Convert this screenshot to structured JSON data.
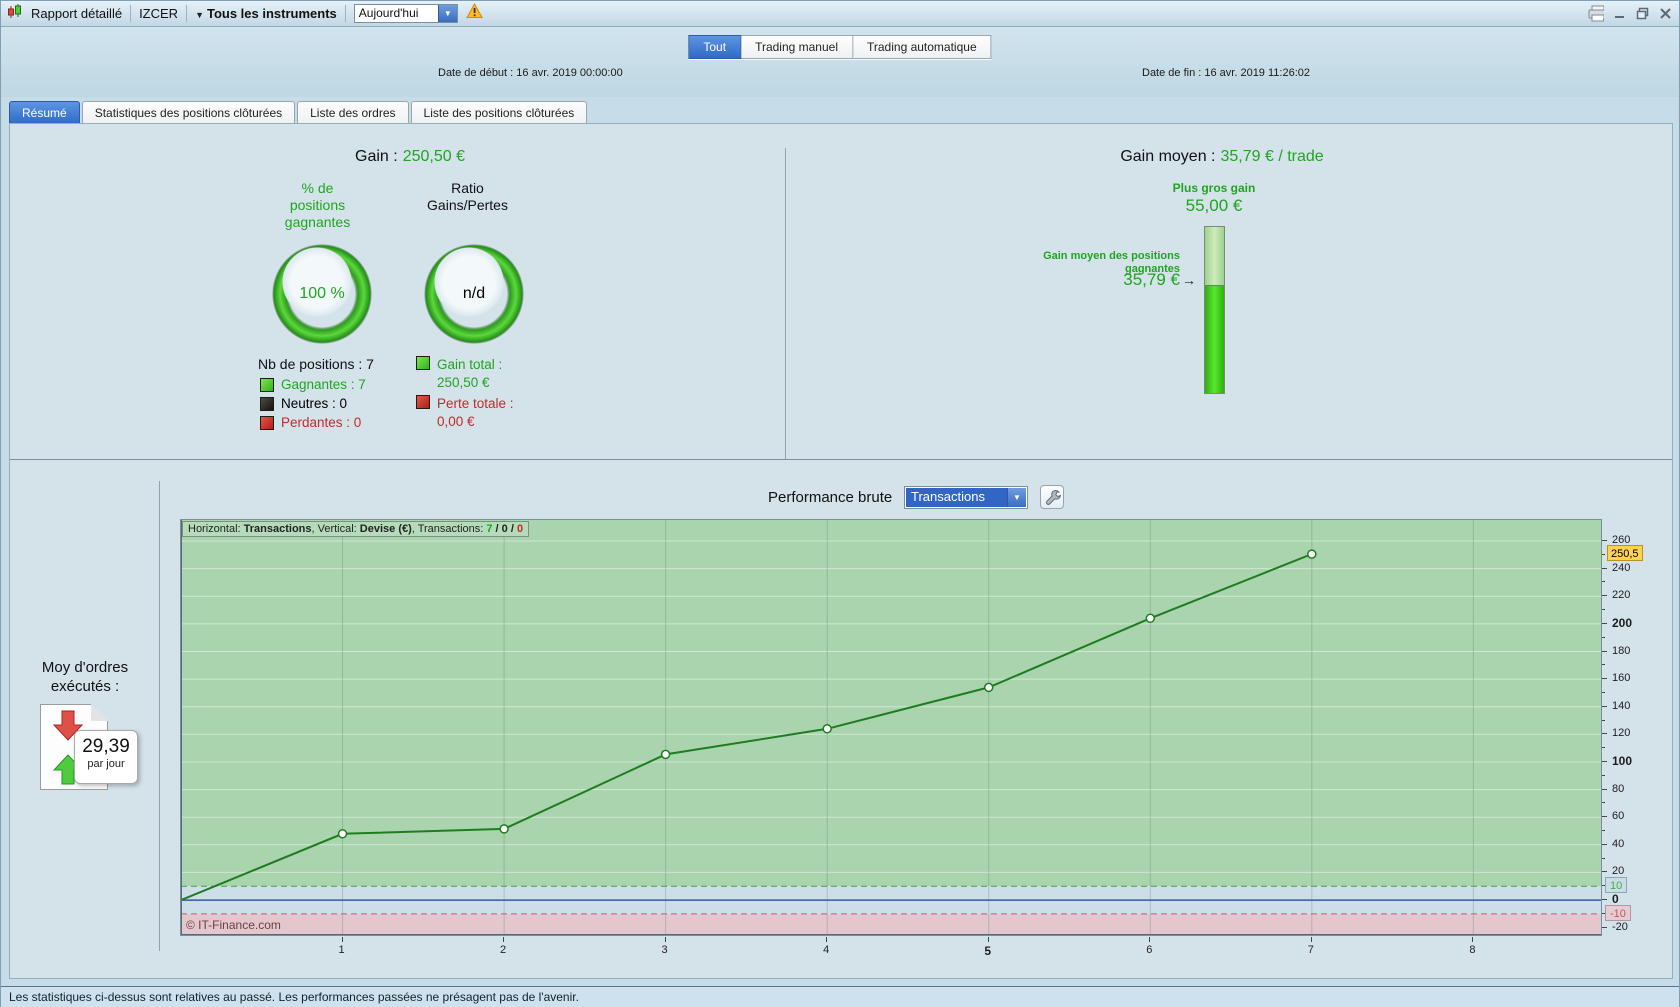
{
  "toolbar": {
    "report_title": "Rapport détaillé",
    "account": "IZCER",
    "instruments_label": "Tous les instruments",
    "period_value": "Aujourd'hui"
  },
  "mode_tabs": [
    {
      "label": "Tout",
      "active": true
    },
    {
      "label": "Trading manuel",
      "active": false
    },
    {
      "label": "Trading automatique",
      "active": false
    }
  ],
  "dates": {
    "start_label": "Date de début :  ",
    "start_value": "16 avr. 2019 00:00:00",
    "end_label": "Date de fin :  ",
    "end_value": "16 avr. 2019 11:26:02"
  },
  "report_tabs": [
    {
      "label": "Résumé",
      "active": true
    },
    {
      "label": "Statistiques des positions clôturées",
      "active": false
    },
    {
      "label": "Liste des ordres",
      "active": false
    },
    {
      "label": "Liste des positions clôturées",
      "active": false
    }
  ],
  "summary": {
    "gain_label": "Gain :",
    "gain_value": "250,50 €",
    "pct_label": "% de\npositions\ngagnantes",
    "pct_value": "100 %",
    "ratio_label": "Ratio\nGains/Pertes",
    "ratio_value": "n/d",
    "nb_positions": "Nb de positions : 7",
    "legend": {
      "win": "Gagnantes : 7",
      "neutral": "Neutres : 0",
      "loss": "Perdantes : 0"
    },
    "totals": {
      "gain_label": "Gain total :",
      "gain_value": "250,50 €",
      "loss_label": "Perte totale :",
      "loss_value": "0,00 €"
    },
    "avg": {
      "label": "Gain moyen :",
      "value": "35,79 € / trade",
      "biggest_label": "Plus gros gain",
      "biggest_value": "55,00 €",
      "avg_win_label": "Gain moyen des positions\ngagnantes",
      "avg_win_arrow": "→",
      "avg_win_value": "35,79 €"
    }
  },
  "orders": {
    "label": "Moy d'ordres\nexécutés :",
    "value": "29,39",
    "unit": "par jour"
  },
  "perf": {
    "title": "Performance brute",
    "selector_value": "Transactions"
  },
  "chart_data": {
    "type": "line",
    "title": "Performance brute",
    "xlabel": "Transactions",
    "ylabel": "Devise (€)",
    "header": {
      "h_label": "Horizontal: ",
      "h_value": "Transactions",
      "v_label": ", Vertical: ",
      "v_value": "Devise (€)",
      "t_label": ", Transactions: ",
      "wins": "7",
      "sep": " / ",
      "neutrals": "0",
      "losses": "0"
    },
    "x": [
      1,
      2,
      3,
      4,
      5,
      6,
      7
    ],
    "y": [
      48,
      51.5,
      105.5,
      124,
      154,
      204,
      250.5
    ],
    "start": [
      0,
      0
    ],
    "x_range": [
      0,
      8.79
    ],
    "y_range": [
      -25.3,
      275.2
    ],
    "gridline_step": 20,
    "upper_threshold": 10,
    "lower_threshold": -10,
    "zero": 0,
    "current_value": 250.5,
    "x_ticks": [
      {
        "v": 1,
        "t": "1"
      },
      {
        "v": 2,
        "t": "2"
      },
      {
        "v": 3,
        "t": "3"
      },
      {
        "v": 4,
        "t": "4"
      },
      {
        "v": 5,
        "t": "5",
        "b": true
      },
      {
        "v": 6,
        "t": "6"
      },
      {
        "v": 7,
        "t": "7"
      },
      {
        "v": 8,
        "t": "8"
      }
    ],
    "y_ticks": [
      {
        "v": 260,
        "t": "260"
      },
      {
        "v": 250.5,
        "t": "250,5",
        "s": "cur"
      },
      {
        "v": 240,
        "t": "240"
      },
      {
        "v": 220,
        "t": "220"
      },
      {
        "v": 200,
        "t": "200",
        "b": true
      },
      {
        "v": 180,
        "t": "180"
      },
      {
        "v": 160,
        "t": "160"
      },
      {
        "v": 140,
        "t": "140"
      },
      {
        "v": 120,
        "t": "120"
      },
      {
        "v": 100,
        "t": "100",
        "b": true
      },
      {
        "v": 80,
        "t": "80"
      },
      {
        "v": 60,
        "t": "60"
      },
      {
        "v": 40,
        "t": "40"
      },
      {
        "v": 20,
        "t": "20"
      },
      {
        "v": 10,
        "t": "10",
        "s": "up"
      },
      {
        "v": 0,
        "t": "0",
        "b": true
      },
      {
        "v": -10,
        "t": "-10",
        "s": "dn"
      },
      {
        "v": -20,
        "t": "-20"
      }
    ],
    "copyright": "© IT-Finance.com",
    "colors": {
      "zone_profit": "#a9d4ae",
      "zone_mid": "#ccdfe9",
      "zone_loss": "#e3c7cc",
      "line": "#1e7d1e",
      "zero_line": "#3a55b0",
      "upper_dash": "#4a9a4a",
      "lower_dash": "#b86070",
      "marker_fill": "#ffffff"
    }
  },
  "status_bar": "Les statistiques ci-dessus sont relatives au passé. Les performances passées ne présagent pas de l'avenir.",
  "colors": {
    "accent_green": "#1fa51f",
    "accent_red": "#c22a2a",
    "tab_active": "#2e6ac6",
    "select_bg": "#3166c5"
  }
}
